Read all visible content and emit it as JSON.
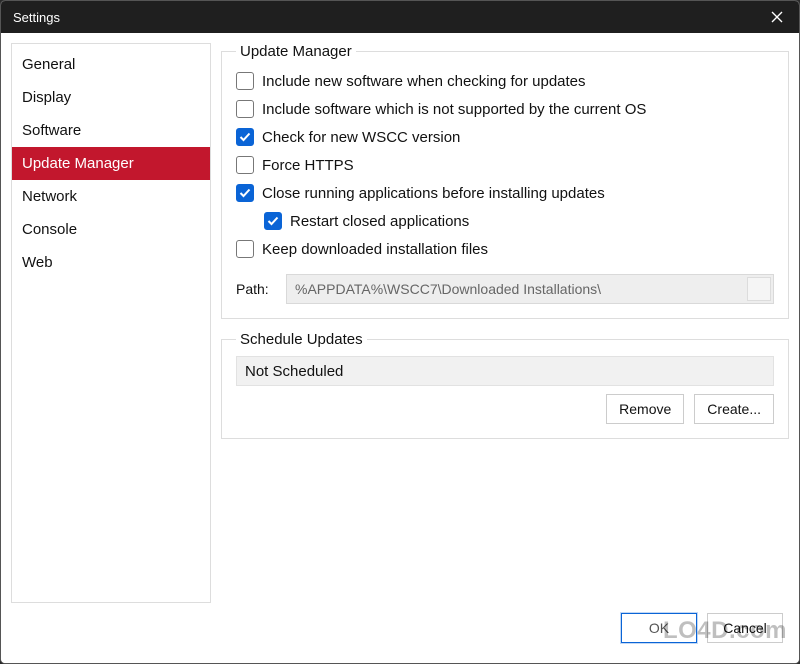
{
  "window": {
    "title": "Settings"
  },
  "sidebar": {
    "items": [
      {
        "label": "General",
        "active": false
      },
      {
        "label": "Display",
        "active": false
      },
      {
        "label": "Software",
        "active": false
      },
      {
        "label": "Update Manager",
        "active": true
      },
      {
        "label": "Network",
        "active": false
      },
      {
        "label": "Console",
        "active": false
      },
      {
        "label": "Web",
        "active": false
      }
    ]
  },
  "update_manager": {
    "legend": "Update Manager",
    "options": {
      "include_new_software": {
        "label": "Include new software when checking for updates",
        "checked": false
      },
      "include_unsupported": {
        "label": "Include software which is not supported by the current OS",
        "checked": false
      },
      "check_wscc": {
        "label": "Check for new WSCC version",
        "checked": true
      },
      "force_https": {
        "label": "Force HTTPS",
        "checked": false
      },
      "close_running": {
        "label": "Close running applications before installing updates",
        "checked": true
      },
      "restart_closed": {
        "label": "Restart closed applications",
        "checked": true
      },
      "keep_downloaded": {
        "label": "Keep downloaded installation files",
        "checked": false
      }
    },
    "path": {
      "label": "Path:",
      "value": "%APPDATA%\\WSCC7\\Downloaded Installations\\"
    }
  },
  "schedule": {
    "legend": "Schedule Updates",
    "value": "Not Scheduled",
    "remove": "Remove",
    "create": "Create..."
  },
  "footer": {
    "ok": "OK",
    "cancel": "Cancel"
  },
  "watermark": "LO4D.com"
}
